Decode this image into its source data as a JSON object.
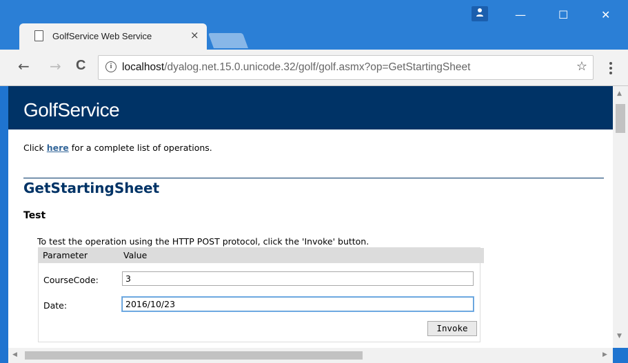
{
  "browser": {
    "tab_title": "GolfService Web Service",
    "tab_close": "×",
    "url_host": "localhost",
    "url_path": "/dyalog.net.15.0.unicode.32/golf/golf.asmx?op=GetStartingSheet",
    "window_controls": {
      "minimize": "—",
      "maximize": "☐",
      "close": "✕"
    },
    "nav": {
      "back": "←",
      "forward": "→",
      "reload": "C"
    },
    "star": "☆",
    "info": "i"
  },
  "page": {
    "banner_title": "GolfService",
    "intro_prefix": "Click ",
    "intro_link": "here",
    "intro_suffix": " for a complete list of operations.",
    "operation_title": "GetStartingSheet",
    "test_heading": "Test",
    "test_note": "To test the operation using the HTTP POST protocol, click the 'Invoke' button.",
    "table": {
      "headers": [
        "Parameter",
        "Value"
      ],
      "rows": [
        {
          "label": "CourseCode:",
          "value": "3"
        },
        {
          "label": "Date:",
          "value": "2016/10/23"
        }
      ]
    },
    "invoke_label": "Invoke"
  },
  "colors": {
    "banner_bg": "#003366",
    "heading": "#003366",
    "link": "#336699",
    "titlebar": "#2b7fd6"
  }
}
